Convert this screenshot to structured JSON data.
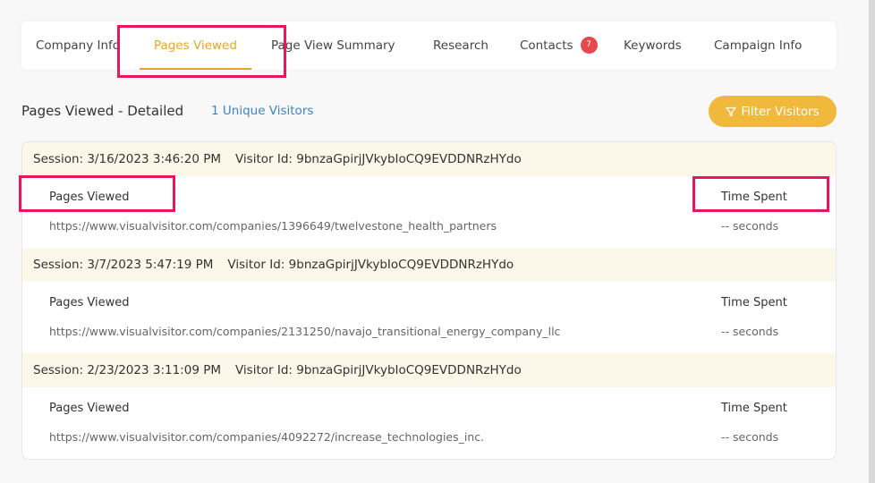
{
  "tabs": [
    {
      "label": "Company Info"
    },
    {
      "label": "Pages Viewed"
    },
    {
      "label": "Page View Summary"
    },
    {
      "label": "Research"
    },
    {
      "label": "Contacts",
      "badge": "7"
    },
    {
      "label": "Keywords"
    },
    {
      "label": "Campaign Info"
    }
  ],
  "active_tab": "Pages Viewed",
  "section": {
    "title": "Pages Viewed - Detailed",
    "unique_visitors": "1 Unique Visitors",
    "filter_button": "Filter Visitors"
  },
  "columns": {
    "pages": "Pages Viewed",
    "time": "Time Spent"
  },
  "sessions": [
    {
      "session": "Session: 3/16/2023 3:46:20 PM",
      "visitor": "Visitor Id: 9bnzaGpirjJVkybIoCQ9EVDDNRzHYdo",
      "url": "https://www.visualvisitor.com/companies/1396649/twelvestone_health_partners",
      "time": "-- seconds"
    },
    {
      "session": "Session: 3/7/2023 5:47:19 PM",
      "visitor": "Visitor Id: 9bnzaGpirjJVkybIoCQ9EVDDNRzHYdo",
      "url": "https://www.visualvisitor.com/companies/2131250/navajo_transitional_energy_company_llc",
      "time": "-- seconds"
    },
    {
      "session": "Session: 2/23/2023 3:11:09 PM",
      "visitor": "Visitor Id: 9bnzaGpirjJVkybIoCQ9EVDDNRzHYdo",
      "url": "https://www.visualvisitor.com/companies/4092272/increase_technologies_inc.",
      "time": "-- seconds"
    }
  ],
  "colors": {
    "accent": "#e8a524",
    "button": "#f0b93b",
    "link": "#3b86c6",
    "badge": "#e5484d",
    "session_bg": "#fbf7e9",
    "highlight": "#e8175d"
  }
}
